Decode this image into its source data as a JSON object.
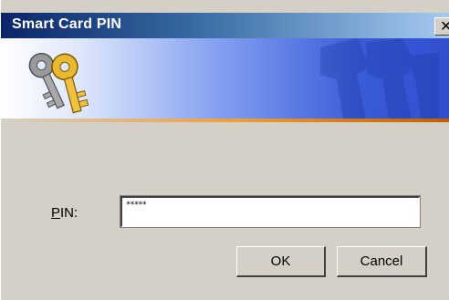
{
  "window": {
    "title": "Smart Card PIN",
    "close_glyph": "✕"
  },
  "banner": {
    "icon": "keys-icon",
    "watermark": "keys-watermark"
  },
  "form": {
    "pin_label_mnemonic": "P",
    "pin_label_rest": "IN:",
    "pin_value": "*****"
  },
  "buttons": {
    "ok": "OK",
    "cancel": "Cancel"
  },
  "colors": {
    "titlebar_start": "#0a246a",
    "titlebar_end": "#a6caf0",
    "dialog_bg": "#d4d0c8",
    "banner_blue": "#3050d0",
    "accent_orange": "#f0a040"
  }
}
